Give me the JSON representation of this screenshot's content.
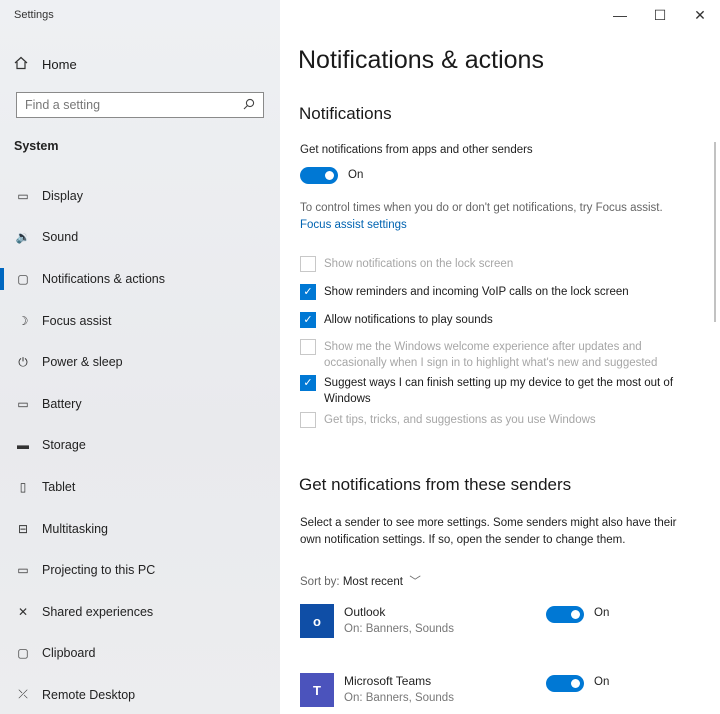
{
  "window": {
    "title": "Settings",
    "controls": {
      "minimize": "—",
      "maximize": "☐",
      "close": "✕"
    }
  },
  "sidebar": {
    "home_label": "Home",
    "search": {
      "placeholder": "Find a setting"
    },
    "section": "System",
    "items": [
      {
        "label": "Display",
        "icon": "monitor-icon",
        "glyph": "▭"
      },
      {
        "label": "Sound",
        "icon": "speaker-icon",
        "glyph": "🔉"
      },
      {
        "label": "Notifications & actions",
        "icon": "notification-icon",
        "glyph": "▢",
        "active": true
      },
      {
        "label": "Focus assist",
        "icon": "moon-icon",
        "glyph": "☽"
      },
      {
        "label": "Power & sleep",
        "icon": "power-icon",
        "glyph": "⏻"
      },
      {
        "label": "Battery",
        "icon": "battery-icon",
        "glyph": "▭"
      },
      {
        "label": "Storage",
        "icon": "storage-icon",
        "glyph": "▬"
      },
      {
        "label": "Tablet",
        "icon": "tablet-icon",
        "glyph": "▯"
      },
      {
        "label": "Multitasking",
        "icon": "multitasking-icon",
        "glyph": "⊟"
      },
      {
        "label": "Projecting to this PC",
        "icon": "projector-icon",
        "glyph": "▭"
      },
      {
        "label": "Shared experiences",
        "icon": "shared-icon",
        "glyph": "✕"
      },
      {
        "label": "Clipboard",
        "icon": "clipboard-icon",
        "glyph": "▢"
      },
      {
        "label": "Remote Desktop",
        "icon": "remote-desktop-icon",
        "glyph": "⤫"
      }
    ]
  },
  "main": {
    "title": "Notifications & actions",
    "notifications_heading": "Notifications",
    "get_notifications_label": "Get notifications from apps and other senders",
    "get_notifications_state": "On",
    "focus_hint": "To control times when you do or don't get notifications, try Focus assist.",
    "focus_link": "Focus assist settings",
    "checkboxes": [
      {
        "label": "Show notifications on the lock screen",
        "checked": false,
        "disabled": true
      },
      {
        "label": "Show reminders and incoming VoIP calls on the lock screen",
        "checked": true,
        "disabled": false
      },
      {
        "label": "Allow notifications to play sounds",
        "checked": true,
        "disabled": false
      },
      {
        "label": "Show me the Windows welcome experience after updates and occasionally when I sign in to highlight what's new and suggested",
        "checked": false,
        "disabled": true
      },
      {
        "label": "Suggest ways I can finish setting up my device to get the most out of Windows",
        "checked": true,
        "disabled": false
      },
      {
        "label": "Get tips, tricks, and suggestions as you use Windows",
        "checked": false,
        "disabled": true
      }
    ],
    "senders_heading": "Get notifications from these senders",
    "senders_desc": "Select a sender to see more settings. Some senders might also have their own notification settings. If so, open the sender to change them.",
    "sort_label": "Sort by:",
    "sort_value": "Most recent",
    "senders": [
      {
        "name": "Outlook",
        "sub": "On: Banners, Sounds",
        "state": "On",
        "color": "#0f4ea6",
        "glyph": "o"
      },
      {
        "name": "Microsoft Teams",
        "sub": "On: Banners, Sounds",
        "state": "On",
        "color": "#4b53bc",
        "glyph": "T"
      }
    ]
  },
  "colors": {
    "accent": "#0078d4",
    "link": "#0063b1"
  }
}
